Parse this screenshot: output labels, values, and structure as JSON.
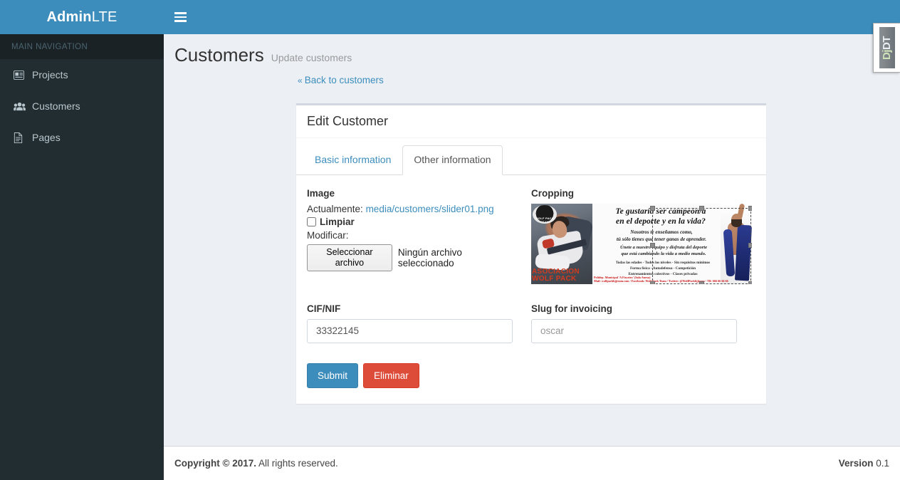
{
  "brand": {
    "bold": "Admin",
    "light": "LTE"
  },
  "navbar": {
    "toggle_icon": "hamburger-icon"
  },
  "sidebar": {
    "header": "MAIN NAVIGATION",
    "items": [
      {
        "label": "Projects",
        "icon": "id-card-icon"
      },
      {
        "label": "Customers",
        "icon": "users-icon"
      },
      {
        "label": "Pages",
        "icon": "file-icon"
      }
    ]
  },
  "page": {
    "title": "Customers",
    "subtitle": "Update customers",
    "back_link": "Back to customers",
    "back_chevron": "«"
  },
  "panel": {
    "title": "Edit Customer",
    "tabs": [
      {
        "label": "Basic information",
        "active": false
      },
      {
        "label": "Other information",
        "active": true
      }
    ]
  },
  "form": {
    "image": {
      "label": "Image",
      "currently_prefix": "Actualmente:",
      "currently_file": "media/customers/slider01.png",
      "clear_label": "Limpiar",
      "clear_checked": false,
      "change_label": "Modificar:",
      "file_button": "Seleccionar archivo",
      "file_status": "Ningún archivo seleccionado"
    },
    "cropping": {
      "label": "Cropping",
      "image_alt": "wolf-pack-team-bjj-banner",
      "banner_text": {
        "headline_1": "Te gustaría ser campeón/a",
        "headline_2": "en el deporte y en la vida?",
        "sub_1": "Nosotros te enseñamos como,",
        "sub_2": "tú sólo tienes que tener ganas de aprender.",
        "sub_3": "Únete a nuestro equipo y disfruta del deporte",
        "sub_4": "que está cambiando la vida a medio mundo.",
        "small_1": "Todas las edades - Todos los niveles - Sin requisitos mínimos",
        "small_2": "Forma física - Autodefensa - Competición",
        "small_3": "Entrenamientos colectivos - Clases privadas",
        "contact_1": "Polidep. Municipal 'A Fieyeiro' (Sala Anexa)",
        "contact_2": "Mail: wolfpackbjjteam.com / Facebook: Wolf Pack Team / Twitter: @WolfPackbjjteam / Tlf: 666 66 66 66",
        "logo_1": "ASOCIACION",
        "logo_2": "WOLF PACK",
        "logo_mark": "WOLF PACK TEAM"
      }
    },
    "cif": {
      "label": "CIF/NIF",
      "value": "33322145",
      "placeholder": ""
    },
    "slug": {
      "label": "Slug for invoicing",
      "value": "",
      "placeholder": "oscar"
    },
    "submit_label": "Submit",
    "delete_label": "Eliminar"
  },
  "footer": {
    "copyright_bold": "Copyright © 2017.",
    "copyright_rest": " All rights reserved.",
    "version_bold": "Version",
    "version_value": " 0.1"
  },
  "debug_toolbar": {
    "label_1": "Dj",
    "label_2": "DT"
  },
  "colors": {
    "navbar": "#3c8dbc",
    "sidebar": "#222d32",
    "content_bg": "#ecf0f5",
    "link": "#3c8dbc",
    "primary": "#3c8dbc",
    "danger": "#dd4b39"
  }
}
